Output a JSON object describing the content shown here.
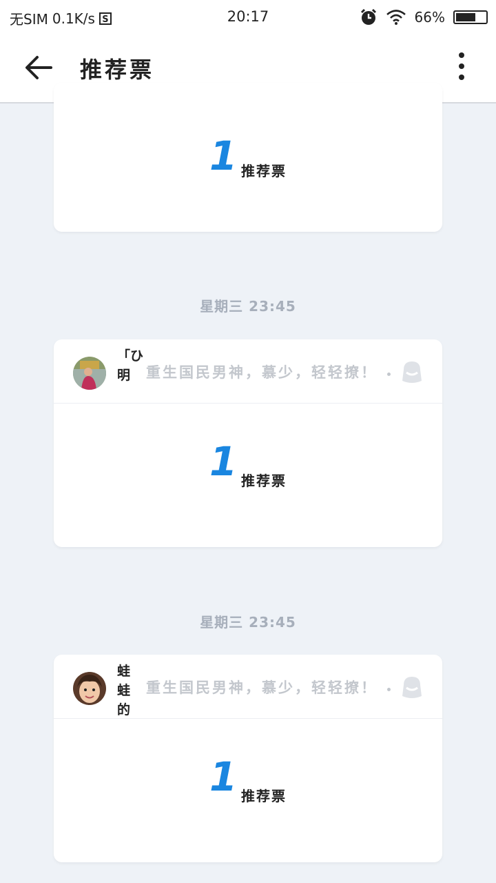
{
  "status_bar": {
    "carrier": "无SIM",
    "speed": "0.1K/s",
    "sim_icon": "S",
    "time": "20:17",
    "battery_text": "66%",
    "battery_level": 0.66
  },
  "header": {
    "title": "推荐票",
    "back_icon": "arrow-left-icon",
    "more_icon": "more-vertical-icon"
  },
  "entries": [
    {
      "vote_count": "1",
      "vote_unit": "推荐票"
    },
    {
      "timestamp": "星期三 23:45",
      "username": "「ひ明",
      "book_title": "重生国民男神，慕少，轻轻撩！",
      "vote_count": "1",
      "vote_unit": "推荐票"
    },
    {
      "timestamp": "星期三 23:45",
      "username": "蛙蛙的",
      "book_title": "重生国民男神，慕少，轻轻撩！",
      "vote_count": "1",
      "vote_unit": "推荐票"
    }
  ],
  "colors": {
    "accent": "#1a86e0",
    "background": "#eef2f7",
    "muted_text": "#a7afbb"
  }
}
